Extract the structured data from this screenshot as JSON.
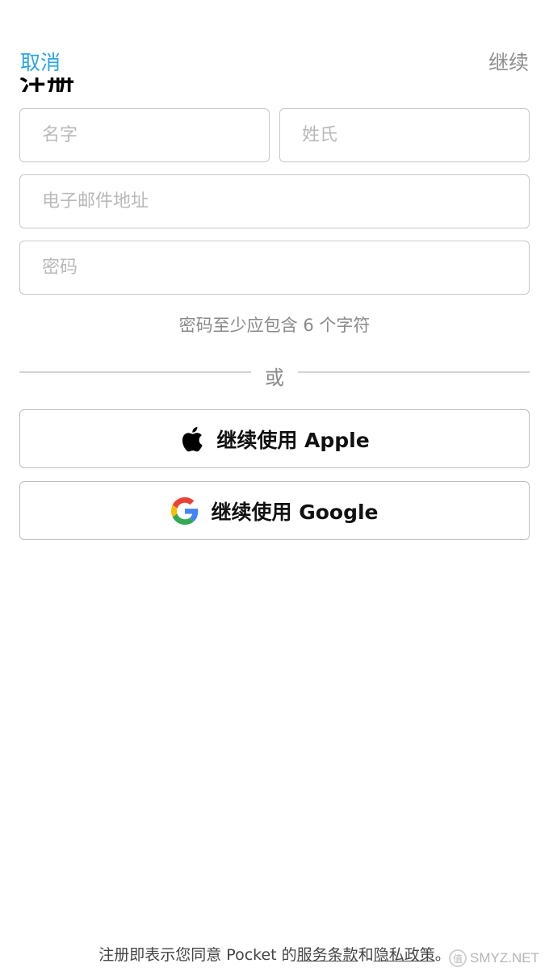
{
  "navbar": {
    "cancel_label": "取消",
    "continue_label": "继续"
  },
  "page": {
    "title": "注册"
  },
  "form": {
    "first_name_placeholder": "名字",
    "last_name_placeholder": "姓氏",
    "email_placeholder": "电子邮件地址",
    "password_placeholder": "密码",
    "password_hint": "密码至少应包含 6 个字符"
  },
  "divider": {
    "label": "或"
  },
  "social": {
    "apple_label": "继续使用 Apple",
    "apple_icon": "apple-logo-icon",
    "google_label": "继续使用 Google",
    "google_icon": "google-logo-icon"
  },
  "footer": {
    "prefix": "注册即表示您同意 Pocket 的",
    "terms_link": "服务条款",
    "conjunction": "和",
    "privacy_link": "隐私政策",
    "suffix": "。"
  },
  "watermark": {
    "text": "SMYZ.NET",
    "mark": "值"
  },
  "colors": {
    "accent": "#2aa5e3",
    "nav_secondary": "#8e8e8e",
    "border": "#c8c8c8",
    "placeholder": "#b9b9b9",
    "google_blue": "#4285F4",
    "google_red": "#EA4335",
    "google_yellow": "#FBBC05",
    "google_green": "#34A853"
  }
}
